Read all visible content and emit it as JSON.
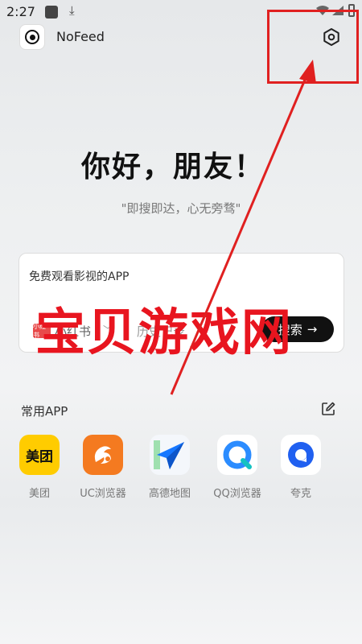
{
  "status_bar": {
    "time": "2:27"
  },
  "header": {
    "app_name": "NoFeed"
  },
  "greeting": "你好，朋友！",
  "slogan": "\"即搜即达，心无旁骛\"",
  "search": {
    "query": "免费观看影视的APP",
    "engine_logo_text": "小红书",
    "engine_name": "小红书",
    "history_label": "历史记录",
    "button_label": "搜索"
  },
  "watermark": "宝贝游戏网",
  "favorites": {
    "title": "常用APP",
    "apps": [
      {
        "label": "美团",
        "icon_text": "美团",
        "icon": "meituan-icon"
      },
      {
        "label": "UC浏览器",
        "icon": "uc-browser-icon"
      },
      {
        "label": "高德地图",
        "icon": "amap-icon"
      },
      {
        "label": "QQ浏览器",
        "icon": "qq-browser-icon"
      },
      {
        "label": "夸克",
        "icon": "quark-icon"
      }
    ]
  },
  "colors": {
    "annotation_red": "#e02020",
    "meituan_yellow": "#ffcc00",
    "uc_orange": "#f47a20",
    "amap_blue": "#1677ff",
    "qq_blue": "#2b8cff",
    "quark_blue": "#2060f0"
  }
}
